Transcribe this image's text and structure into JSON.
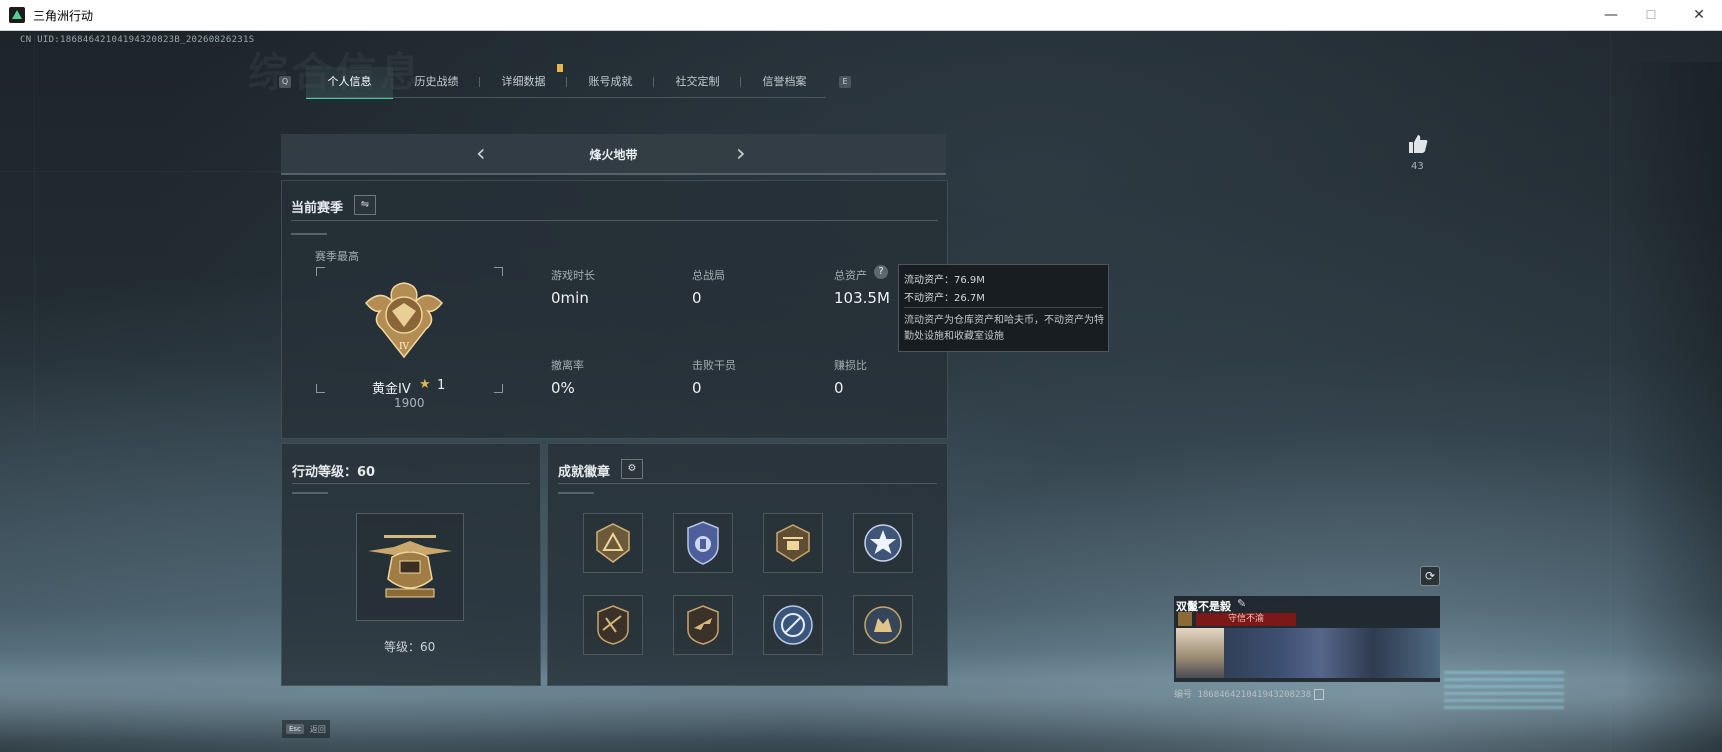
{
  "window": {
    "title": "三角洲行动",
    "minimize": "—",
    "maximize": "☐",
    "close": "✕"
  },
  "uid_line": "CN UID:18684642104194320823B_20260826231S",
  "watermark": "综合信息",
  "tabs": {
    "left_key": "Q",
    "right_key": "E",
    "items": [
      {
        "label": "个人信息",
        "active": true
      },
      {
        "label": "历史战绩",
        "active": false
      },
      {
        "label": "详细数据",
        "active": false
      },
      {
        "label": "账号成就",
        "active": false
      },
      {
        "label": "社交定制",
        "active": false
      },
      {
        "label": "信誉档案",
        "active": false
      }
    ]
  },
  "mode": {
    "label": "烽火地带",
    "prev": "‹",
    "next": "›"
  },
  "season": {
    "title": "当前赛季",
    "switch_icon": "⇋",
    "best_label": "赛季最高",
    "rank_name": "黄金IV",
    "rank_star": "★",
    "rank_stars": "1",
    "rank_score": "1900",
    "rank_badge_text": "IV",
    "stats": [
      {
        "label": "游戏时长",
        "value": "0min"
      },
      {
        "label": "总战局",
        "value": "0"
      },
      {
        "label": "总资产",
        "value": "103.5M"
      },
      {
        "label": "撤离率",
        "value": "0%"
      },
      {
        "label": "击败干员",
        "value": "0"
      },
      {
        "label": "赚损比",
        "value": "0"
      }
    ]
  },
  "tooltip": {
    "liquid": "流动资产：76.9M",
    "fixed": "不动资产：26.7M",
    "desc": "流动资产为仓库资产和哈夫币，不动资产为特勤处设施和收藏室设施"
  },
  "level": {
    "title": "行动等级：60",
    "label": "等级：60"
  },
  "achievements": {
    "title": "成就徽章",
    "settings_icon": "⚙",
    "badges": [
      "delta-badge",
      "shield-badge",
      "heli-badge",
      "star-badge",
      "rifle-badge-1",
      "rifle-badge-2",
      "emblem-badge",
      "beast-badge"
    ]
  },
  "likes": {
    "count": "43"
  },
  "player_card": {
    "name": "双鬣不是毅",
    "tag": "守信不渝",
    "id_prefix": "编号",
    "id": "186846421041943208238"
  },
  "footer": {
    "esc_key": "Esc",
    "esc_label": "返回"
  },
  "colors": {
    "accent": "#3fd28f",
    "notification": "#e7b54d",
    "tag_red": "#7b1818"
  }
}
